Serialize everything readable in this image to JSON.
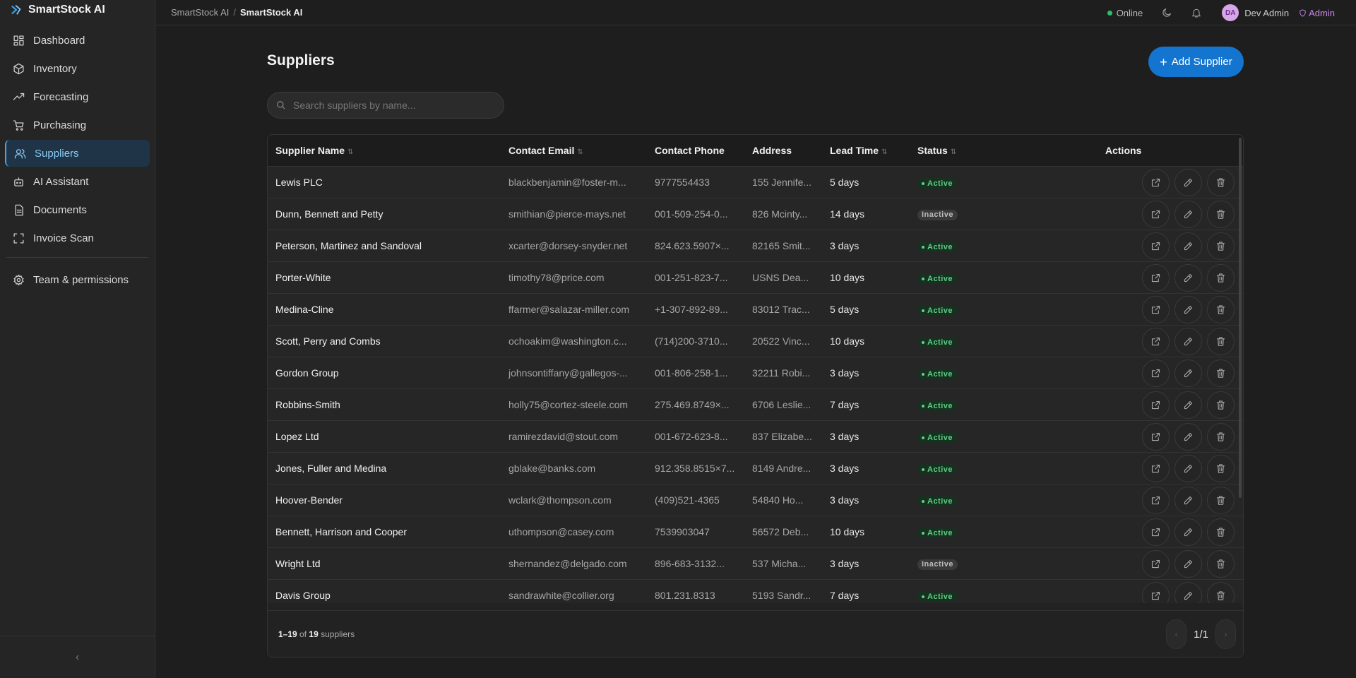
{
  "app": {
    "name": "SmartStock AI"
  },
  "sidebar": {
    "items": [
      {
        "label": "Dashboard",
        "icon": "dashboard-icon"
      },
      {
        "label": "Inventory",
        "icon": "box-icon"
      },
      {
        "label": "Forecasting",
        "icon": "trend-icon"
      },
      {
        "label": "Purchasing",
        "icon": "cart-icon"
      },
      {
        "label": "Suppliers",
        "icon": "users-icon"
      },
      {
        "label": "AI Assistant",
        "icon": "bot-icon"
      },
      {
        "label": "Documents",
        "icon": "document-icon"
      },
      {
        "label": "Invoice Scan",
        "icon": "scan-icon"
      }
    ],
    "team": {
      "label": "Team & permissions",
      "icon": "gear-icon"
    },
    "collapse_glyph": "‹"
  },
  "topbar": {
    "breadcrumb_root": "SmartStock AI",
    "breadcrumb_sep": "/",
    "breadcrumb_current": "SmartStock AI",
    "status": "Online",
    "avatar_initials": "DA",
    "user_name": "Dev Admin",
    "role": "Admin"
  },
  "page": {
    "title": "Suppliers",
    "add_button": "Add Supplier",
    "search_placeholder": "Search suppliers by name..."
  },
  "table": {
    "columns": {
      "name": "Supplier Name",
      "email": "Contact Email",
      "phone": "Contact Phone",
      "address": "Address",
      "lead": "Lead Time",
      "status": "Status",
      "actions": "Actions"
    },
    "rows": [
      {
        "name": "Lewis PLC",
        "email": "blackbenjamin@foster-m...",
        "phone": "9777554433",
        "address": "155 Jennife...",
        "lead": "5 days",
        "status": "Active"
      },
      {
        "name": "Dunn, Bennett and Petty",
        "email": "smithian@pierce-mays.net",
        "phone": "001-509-254-0...",
        "address": "826 Mcinty...",
        "lead": "14 days",
        "status": "Inactive"
      },
      {
        "name": "Peterson, Martinez and Sandoval",
        "email": "xcarter@dorsey-snyder.net",
        "phone": "824.623.5907×...",
        "address": "82165 Smit...",
        "lead": "3 days",
        "status": "Active"
      },
      {
        "name": "Porter-White",
        "email": "timothy78@price.com",
        "phone": "001-251-823-7...",
        "address": "USNS Dea...",
        "lead": "10 days",
        "status": "Active"
      },
      {
        "name": "Medina-Cline",
        "email": "ffarmer@salazar-miller.com",
        "phone": "+1-307-892-89...",
        "address": "83012 Trac...",
        "lead": "5 days",
        "status": "Active"
      },
      {
        "name": "Scott, Perry and Combs",
        "email": "ochoakim@washington.c...",
        "phone": "(714)200-3710...",
        "address": "20522 Vinc...",
        "lead": "10 days",
        "status": "Active"
      },
      {
        "name": "Gordon Group",
        "email": "johnsontiffany@gallegos-...",
        "phone": "001-806-258-1...",
        "address": "32211 Robi...",
        "lead": "3 days",
        "status": "Active"
      },
      {
        "name": "Robbins-Smith",
        "email": "holly75@cortez-steele.com",
        "phone": "275.469.8749×...",
        "address": "6706 Leslie...",
        "lead": "7 days",
        "status": "Active"
      },
      {
        "name": "Lopez Ltd",
        "email": "ramirezdavid@stout.com",
        "phone": "001-672-623-8...",
        "address": "837 Elizabe...",
        "lead": "3 days",
        "status": "Active"
      },
      {
        "name": "Jones, Fuller and Medina",
        "email": "gblake@banks.com",
        "phone": "912.358.8515×7...",
        "address": "8149 Andre...",
        "lead": "3 days",
        "status": "Active"
      },
      {
        "name": "Hoover-Bender",
        "email": "wclark@thompson.com",
        "phone": "(409)521-4365",
        "address": "54840 Ho...",
        "lead": "3 days",
        "status": "Active"
      },
      {
        "name": "Bennett, Harrison and Cooper",
        "email": "uthompson@casey.com",
        "phone": "7539903047",
        "address": "56572 Deb...",
        "lead": "10 days",
        "status": "Active"
      },
      {
        "name": "Wright Ltd",
        "email": "shernandez@delgado.com",
        "phone": "896-683-3132...",
        "address": "537 Micha...",
        "lead": "3 days",
        "status": "Inactive"
      },
      {
        "name": "Davis Group",
        "email": "sandrawhite@collier.org",
        "phone": "801.231.8313",
        "address": "5193 Sandr...",
        "lead": "7 days",
        "status": "Active"
      }
    ],
    "footer": {
      "range": "1–19",
      "of": "of",
      "total": "19",
      "unit": "suppliers"
    },
    "pagination": {
      "page": "1/1",
      "prev_glyph": "‹",
      "next_glyph": "›"
    }
  },
  "colors": {
    "accent": "#1475d0",
    "active_green": "#5fd18a",
    "role_purple": "#c986e8",
    "online_green": "#2ebd6b"
  }
}
